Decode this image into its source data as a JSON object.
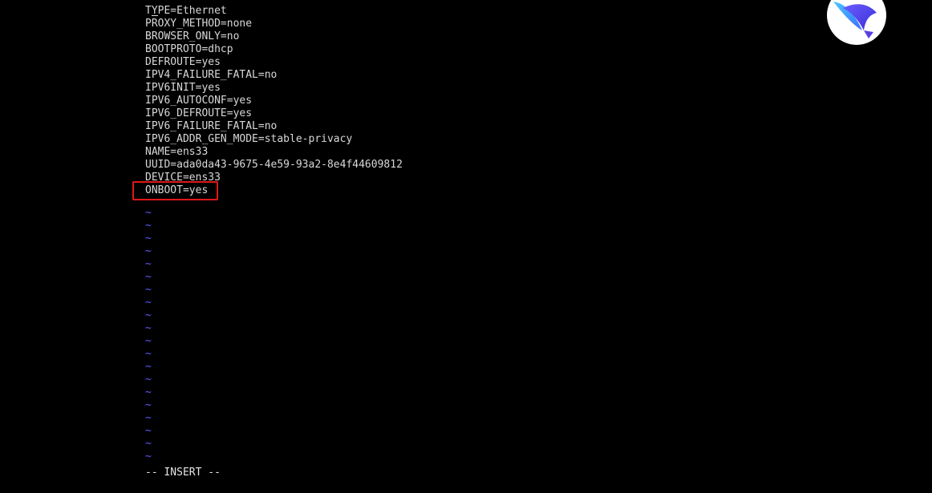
{
  "editor": {
    "file_lines": [
      "TYPE=Ethernet",
      "PROXY_METHOD=none",
      "BROWSER_ONLY=no",
      "BOOTPROTO=dhcp",
      "DEFROUTE=yes",
      "IPV4_FAILURE_FATAL=no",
      "IPV6INIT=yes",
      "IPV6_AUTOCONF=yes",
      "IPV6_DEFROUTE=yes",
      "IPV6_FAILURE_FATAL=no",
      "IPV6_ADDR_GEN_MODE=stable-privacy",
      "NAME=ens33",
      "UUID=ada0da43-9675-4e59-93a2-8e4f44609812",
      "DEVICE=ens33",
      "ONBOOT=yes"
    ],
    "empty_line_marker": "~",
    "empty_line_count": 20,
    "mode_indicator": "-- INSERT --",
    "highlighted_line": "ONBOOT=yes"
  },
  "colors": {
    "background": "#000000",
    "text": "#d8d8d8",
    "tilde": "#5b5bff",
    "highlight_border": "#e01818"
  },
  "logo": {
    "icon": "bird-logo-icon"
  }
}
